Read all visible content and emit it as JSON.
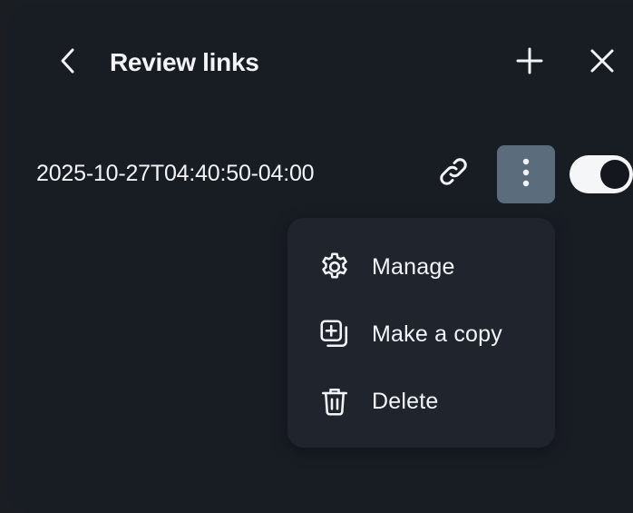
{
  "header": {
    "title": "Review links"
  },
  "icons": {
    "back": "chevron-left-icon",
    "add": "plus-icon",
    "close": "close-icon",
    "copy_link": "link-icon",
    "more": "more-vertical-icon",
    "manage": "gear-icon",
    "make_copy": "duplicate-icon",
    "delete": "trash-icon"
  },
  "review_link": {
    "name": "2025-10-27T04:40:50-04:00",
    "enabled": true
  },
  "menu": {
    "items": [
      {
        "label": "Manage"
      },
      {
        "label": "Make a copy"
      },
      {
        "label": "Delete"
      }
    ]
  },
  "colors": {
    "panel_bg": "#181c23",
    "menu_bg": "#20252d",
    "more_button_active": "#5b6d7c",
    "text": "#f2f4f7"
  }
}
